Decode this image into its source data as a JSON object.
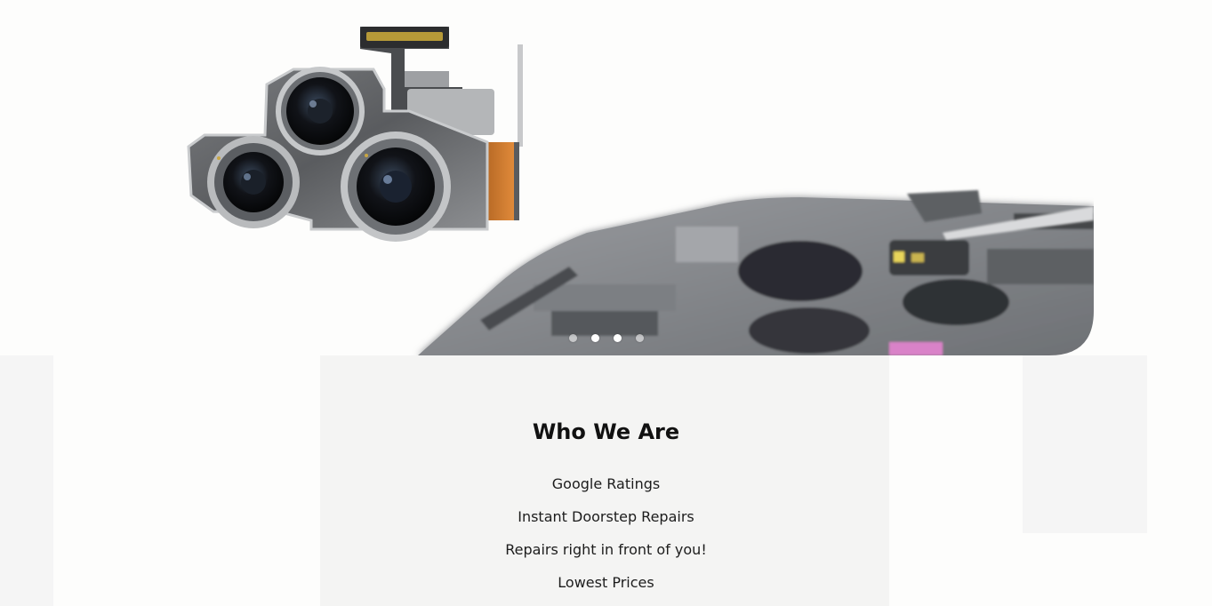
{
  "carousel": {
    "slide_count": 4,
    "active_slide": 2,
    "slide_image": "phone-camera-module-repair-photo"
  },
  "about": {
    "title": "Who We Are",
    "features": [
      {
        "label": "Google Ratings"
      },
      {
        "label": "Instant Doorstep Repairs"
      },
      {
        "label": "Repairs right in front of you!"
      },
      {
        "label": "Lowest Prices"
      }
    ]
  },
  "colors": {
    "page_background": "#fdfdfc",
    "heading_text": "#111111",
    "body_text": "#1c1c1c",
    "dot_active": "#ffffff"
  }
}
